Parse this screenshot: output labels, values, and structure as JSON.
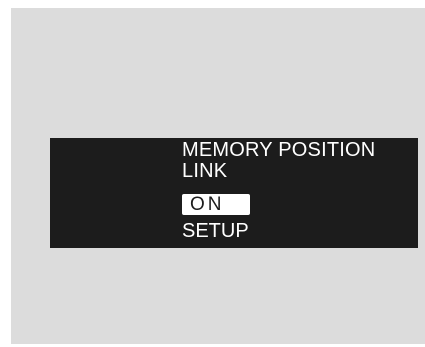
{
  "screen": {
    "title_line1": "MEMORY POSITION",
    "title_line2": "LINK",
    "options": [
      {
        "label": "ON",
        "selected": true
      },
      {
        "label": "SETUP",
        "selected": false
      }
    ]
  },
  "colors": {
    "background_panel": "#dcdcdc",
    "display": "#1c1c1c",
    "text": "#ffffff",
    "highlight": "#ffffff"
  }
}
